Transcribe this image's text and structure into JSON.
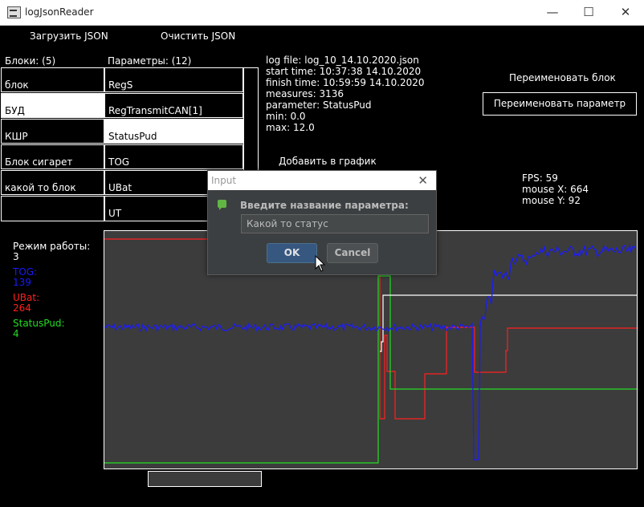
{
  "window": {
    "title": "logJsonReader",
    "minimize": "—",
    "maximize": "☐",
    "close": "✕"
  },
  "menu": {
    "load": "Загрузить JSON",
    "clear": "Очистить JSON"
  },
  "blocks": {
    "header": "Блоки: (5)",
    "items": [
      "блок",
      "БУД",
      "КШР",
      "Блок сигарет",
      "какой то блок",
      ""
    ],
    "selected_index": 1
  },
  "params": {
    "header": "Параметры: (12)",
    "items": [
      "RegS",
      "RegTransmitCAN[1]",
      "StatusPud",
      "TOG",
      "UBat",
      "UT"
    ],
    "selected_index": 2
  },
  "info": {
    "log_file": "log file: log_10_14.10.2020.json",
    "start_time": "start time: 10:37:38 14.10.2020",
    "finish_time": "finish time: 10:59:59 14.10.2020",
    "measures": "measures: 3136",
    "parameter": "parameter: StatusPud",
    "min": "min: 0.0",
    "max": "max: 12.0"
  },
  "buttons": {
    "rename_block": "Переименовать блок",
    "rename_param": "Переименовать параметр",
    "add_to_graph": "Добавить в график"
  },
  "stats": {
    "fps": "FPS: 59",
    "mouse_x": "mouse X: 664",
    "mouse_y": "mouse Y: 92"
  },
  "legend": [
    {
      "name": "Режим работы:",
      "value": "3",
      "color": "#ffffff"
    },
    {
      "name": "TOG:",
      "value": "139",
      "color": "#1a1aff"
    },
    {
      "name": "UBat:",
      "value": "264",
      "color": "#ff2020"
    },
    {
      "name": "StatusPud:",
      "value": "4",
      "color": "#22dd22"
    }
  ],
  "dialog": {
    "title": "Input",
    "close": "✕",
    "prompt": "Введите название параметра:",
    "value": "Какой то статус",
    "ok": "OK",
    "cancel": "Cancel"
  },
  "chart_data": {
    "type": "line",
    "series": [
      {
        "name": "Режим работы",
        "color": "#ffffff"
      },
      {
        "name": "TOG",
        "color": "#1a1aff"
      },
      {
        "name": "UBat",
        "color": "#ff2020"
      },
      {
        "name": "StatusPud",
        "color": "#22dd22"
      }
    ]
  }
}
